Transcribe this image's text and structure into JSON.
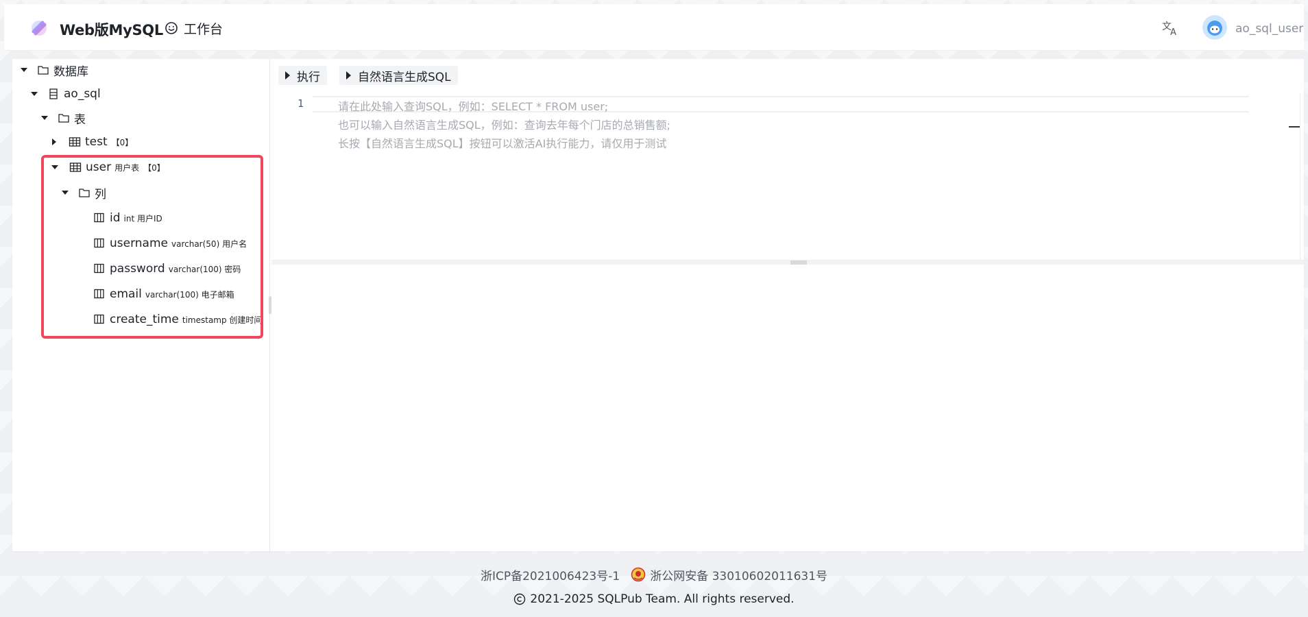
{
  "header": {
    "app_title": "Web版MySQL",
    "workbench_label": "工作台",
    "username": "ao_sql_user"
  },
  "tree": {
    "root": "数据库",
    "database": "ao_sql",
    "tables_folder": "表",
    "tables": [
      {
        "name": "test",
        "comment": "",
        "count": "【0】",
        "expanded": false
      },
      {
        "name": "user",
        "comment": "用户表",
        "count": "【0】",
        "expanded": true
      }
    ],
    "columns_folder": "列",
    "columns": [
      {
        "name": "id",
        "detail": "int 用户ID"
      },
      {
        "name": "username",
        "detail": "varchar(50) 用户名"
      },
      {
        "name": "password",
        "detail": "varchar(100) 密码"
      },
      {
        "name": "email",
        "detail": "varchar(100) 电子邮箱"
      },
      {
        "name": "create_time",
        "detail": "timestamp 创建时间"
      }
    ]
  },
  "toolbar": {
    "run_label": "执行",
    "nl2sql_label": "自然语言生成SQL"
  },
  "editor": {
    "line_number": "1",
    "placeholder_lines": [
      "请在此处输入查询SQL，例如：SELECT * FROM user;",
      "也可以输入自然语言生成SQL，例如：查询去年每个门店的总销售额;",
      "长按【自然语言生成SQL】按钮可以激活AI执行能力，请仅用于测试"
    ]
  },
  "footer": {
    "icp": "浙ICP备2021006423号-1",
    "police": "浙公网安备 33010602011631号",
    "copyright": "2021-2025 SQLPub Team. All rights reserved."
  },
  "colors": {
    "highlight": "#f0475d",
    "text": "#1f2329",
    "placeholder": "#a7aab0"
  },
  "icons": [
    "logo-icon",
    "smile-icon",
    "translate-icon",
    "avatar-icon",
    "folder-icon",
    "database-icon",
    "table-icon",
    "column-icon",
    "play-icon",
    "police-badge-icon",
    "copyright-icon"
  ]
}
